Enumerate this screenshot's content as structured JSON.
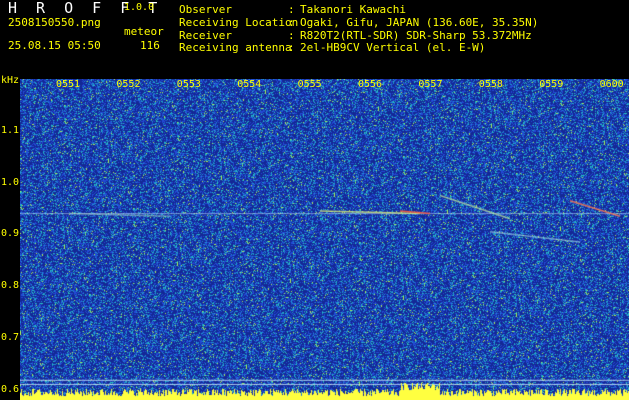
{
  "header": {
    "app_title": "H R O F F T",
    "version": "1.0.0",
    "filename": "2508150550.png",
    "timestamp": "25.08.15 05:50",
    "mode_label": "meteor",
    "count": "116",
    "info": [
      {
        "key": "Observer",
        "sep": ":",
        "value": "Takanori Kawachi"
      },
      {
        "key": "Receiving Location",
        "sep": ":",
        "value": "Ogaki, Gifu, JAPAN (136.60E, 35.35N)"
      },
      {
        "key": "Receiver",
        "sep": ":",
        "value": "R820T2(RTL-SDR) SDR-Sharp 53.372MHz"
      },
      {
        "key": "Receiving antenna",
        "sep": ":",
        "value": "2el-HB9CV Vertical (el. E-W)"
      }
    ]
  },
  "chart_data": {
    "type": "heatmap",
    "ylabel": "kHz",
    "y_ticks": [
      "1.1",
      "1.0",
      "0.9",
      "0.8",
      "0.7",
      "0.6"
    ],
    "x_ticks": [
      "0551",
      "0552",
      "0553",
      "0554",
      "0555",
      "0556",
      "0557",
      "0558",
      "0559",
      "0600"
    ],
    "ylim": [
      0.58,
      1.2
    ],
    "grid": false,
    "colors": {
      "background": "#1a2fa0",
      "noise_low": "#2a49d8",
      "noise_mid": "#1fb8c8",
      "noise_high": "#b0f050",
      "trace": "#ffffff",
      "label": "#ffff00",
      "hot": "#ff4040"
    }
  }
}
